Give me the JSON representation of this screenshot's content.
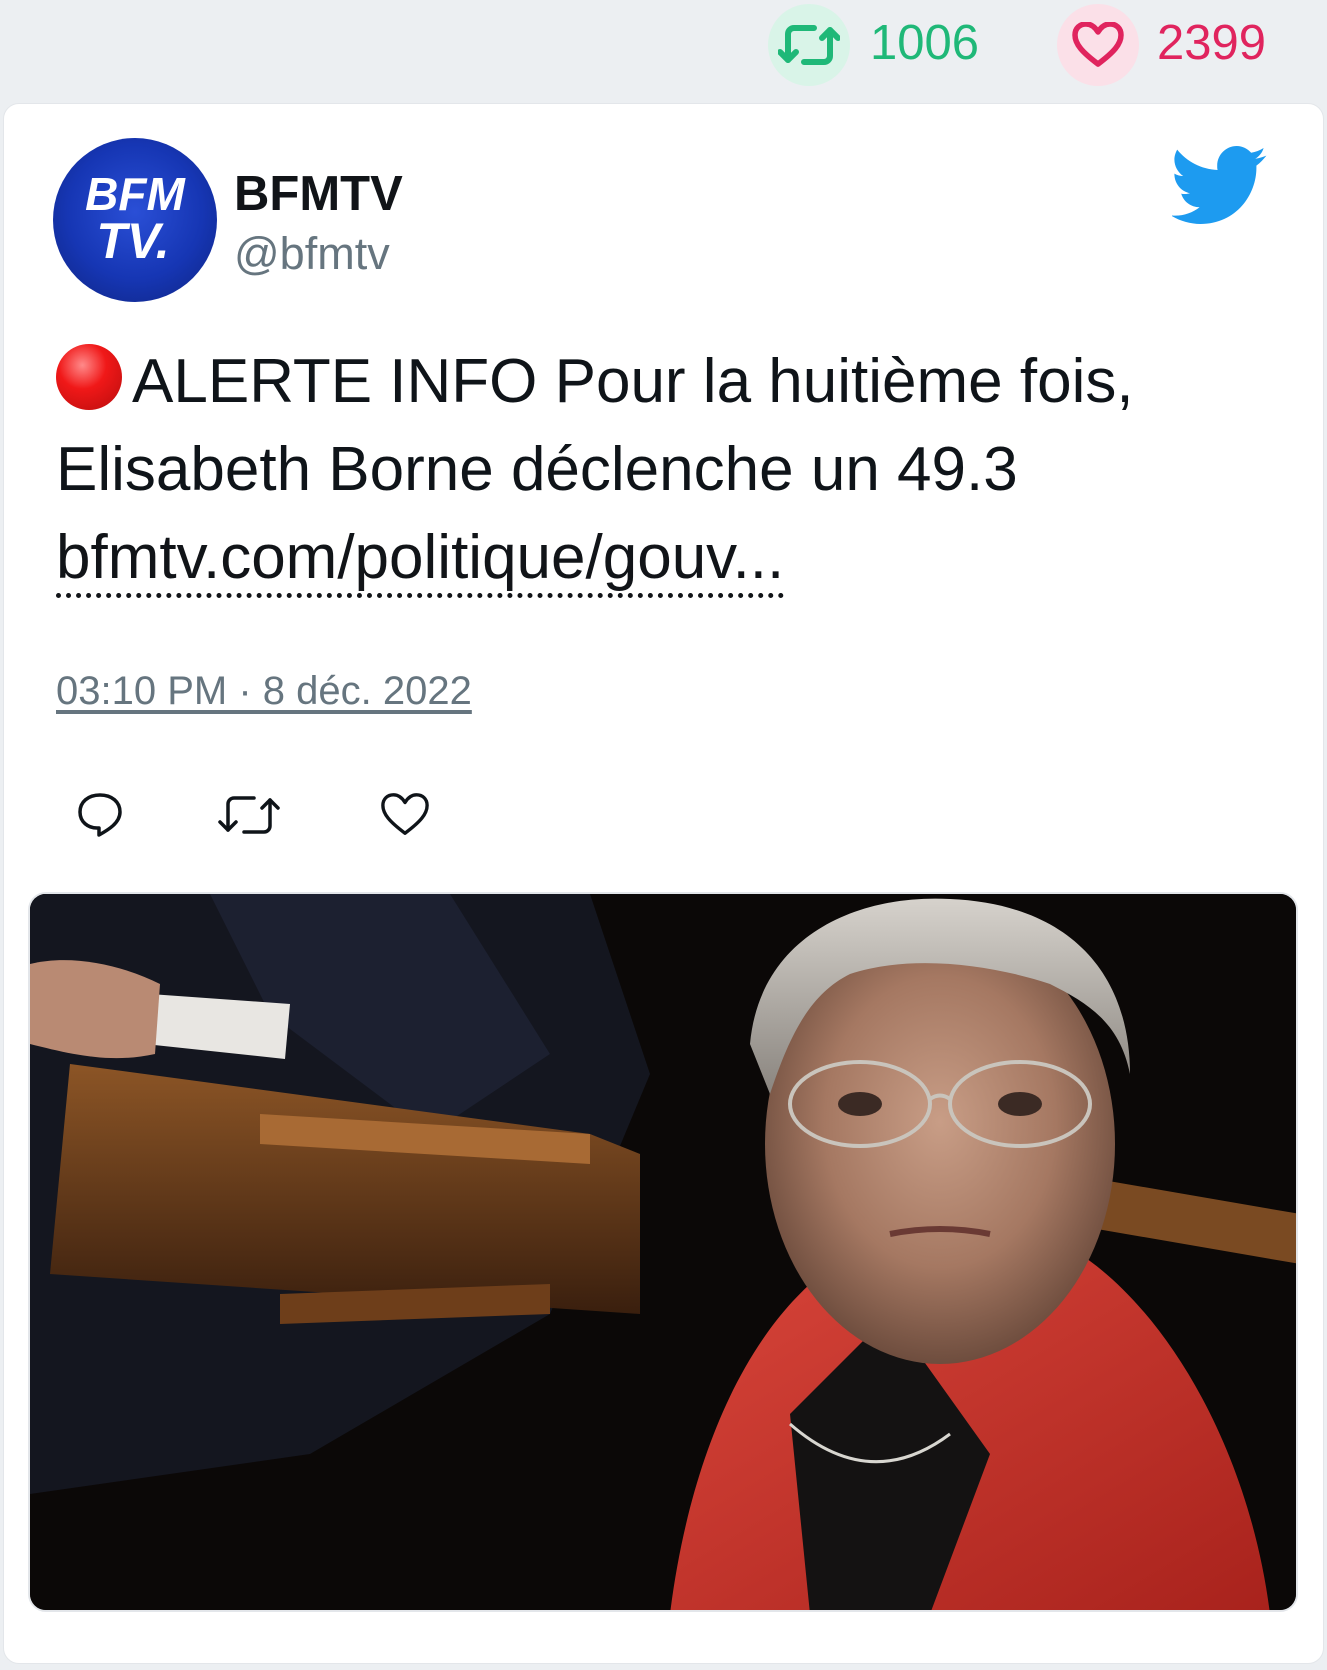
{
  "stats": {
    "retweets": "1006",
    "likes": "2399",
    "retweet_color": "#1fb878",
    "like_color": "#e0245e"
  },
  "tweet": {
    "author_name": "BFMTV",
    "author_handle": "@bfmtv",
    "avatar_logo_line1": "BFM",
    "avatar_logo_line2": "TV.",
    "text": "ALERTE INFO Pour la huitième fois, Elisabeth Borne déclenche un 49.3",
    "link": "bfmtv.com/politique/gouv...",
    "timestamp": "03:10 PM · 8 déc. 2022",
    "alert_icon": "red-circle-icon",
    "brand_icon": "twitter-bird-icon",
    "action_icons": [
      "reply-icon",
      "retweet-icon",
      "like-icon"
    ]
  },
  "colors": {
    "twitter_blue": "#1d9bf0",
    "text": "#0f1419",
    "muted": "#66757f"
  }
}
